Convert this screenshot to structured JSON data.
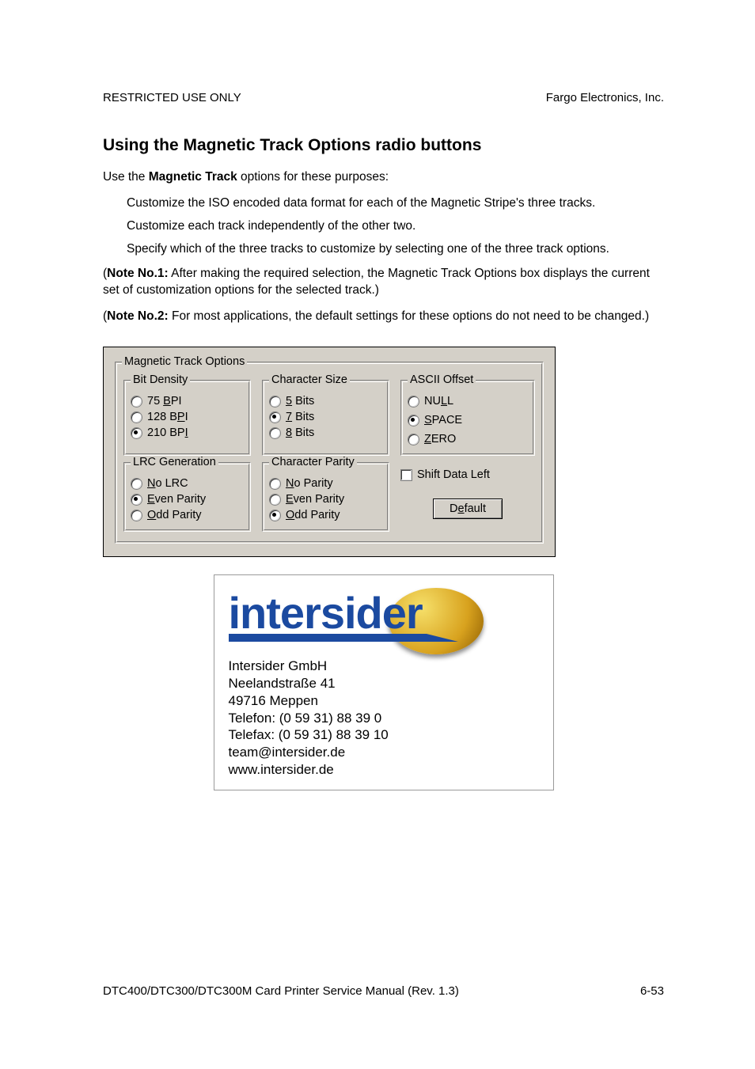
{
  "header": {
    "left": "RESTRICTED USE ONLY",
    "right": "Fargo Electronics, Inc."
  },
  "heading": "Using the Magnetic Track Options radio buttons",
  "intro_pre": "Use the ",
  "intro_bold": "Magnetic Track",
  "intro_post": " options for these purposes:",
  "bullets": [
    "Customize the ISO encoded data format for each of the Magnetic Stripe's three tracks.",
    "Customize each track independently of the other two.",
    "Specify which of the three tracks to customize by selecting one of the three track options."
  ],
  "note1_label": "Note No.1:",
  "note1_body": "  After making the required selection, the Magnetic Track Options box displays the current set of customization options for the selected track.)",
  "note2_label": "Note No.2:",
  "note2_body": "  For most applications, the default settings for these options do not need to be changed.)",
  "note_open": "(",
  "dialog": {
    "outer_legend": "Magnetic Track Options",
    "bit_density": {
      "legend": "Bit Density",
      "opts": [
        {
          "pre": "  75 ",
          "u": "B",
          "post": "PI",
          "checked": false
        },
        {
          "pre": "128 B",
          "u": "P",
          "post": "I",
          "checked": false
        },
        {
          "pre": "210 BP",
          "u": "I",
          "post": "",
          "checked": true
        }
      ]
    },
    "char_size": {
      "legend": "Character Size",
      "opts": [
        {
          "u": "5",
          "post": " Bits",
          "checked": false
        },
        {
          "u": "7",
          "post": " Bits",
          "checked": true
        },
        {
          "u": "8",
          "post": " Bits",
          "checked": false
        }
      ]
    },
    "ascii_offset": {
      "legend": "ASCII Offset",
      "opts": [
        {
          "pre": "NU",
          "u": "L",
          "post": "L",
          "checked": false
        },
        {
          "u": "S",
          "post": "PACE",
          "checked": true
        },
        {
          "u": "Z",
          "post": "ERO",
          "checked": false
        }
      ]
    },
    "lrc": {
      "legend": "LRC Generation",
      "opts": [
        {
          "u": "N",
          "post": "o LRC",
          "checked": false
        },
        {
          "u": "E",
          "post": "ven Parity",
          "checked": true
        },
        {
          "u": "O",
          "post": "dd Parity",
          "checked": false
        }
      ]
    },
    "char_parity": {
      "legend": "Character Parity",
      "opts": [
        {
          "u": "N",
          "post": "o Parity",
          "checked": false
        },
        {
          "u": "E",
          "post": "ven Parity",
          "checked": false
        },
        {
          "u": "O",
          "post": "dd Parity",
          "checked": true
        }
      ]
    },
    "shift_label": "Shift Data Left",
    "default_pre": "D",
    "default_u": "e",
    "default_post": "fault"
  },
  "intersider": {
    "logo_text": "intersider",
    "lines": [
      "Intersider GmbH",
      "Neelandstraße 41",
      "49716 Meppen",
      "Telefon: (0 59 31) 88 39 0",
      "Telefax: (0 59 31) 88 39 10",
      "team@intersider.de",
      "www.intersider.de"
    ]
  },
  "footer": {
    "left": "DTC400/DTC300/DTC300M Card Printer Service Manual (Rev. 1.3)",
    "right": "6-53"
  }
}
